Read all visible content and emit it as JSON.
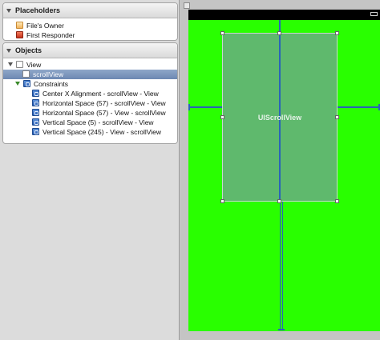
{
  "outline": {
    "placeholders": {
      "title": "Placeholders",
      "items": [
        {
          "label": "File's Owner",
          "icon": "files-owner-icon"
        },
        {
          "label": "First Responder",
          "icon": "first-responder-icon"
        }
      ]
    },
    "objects": {
      "title": "Objects",
      "view": "View",
      "scroll_view": "scrollView",
      "constraints": "Constraints",
      "constraint_items": [
        "Center X Alignment - scrollView - View",
        "Horizontal Space (57) - scrollView - View",
        "Horizontal Space (57) - View - scrollView",
        "Vertical Space (5) - scrollView - View",
        "Vertical Space (245) - View - scrollView"
      ]
    }
  },
  "canvas": {
    "scroll_view_label": "UIScrollView",
    "background_color": "#29ff00",
    "scroll_view_color": "#6ea58c",
    "constraint_color": "#2a63b8"
  }
}
